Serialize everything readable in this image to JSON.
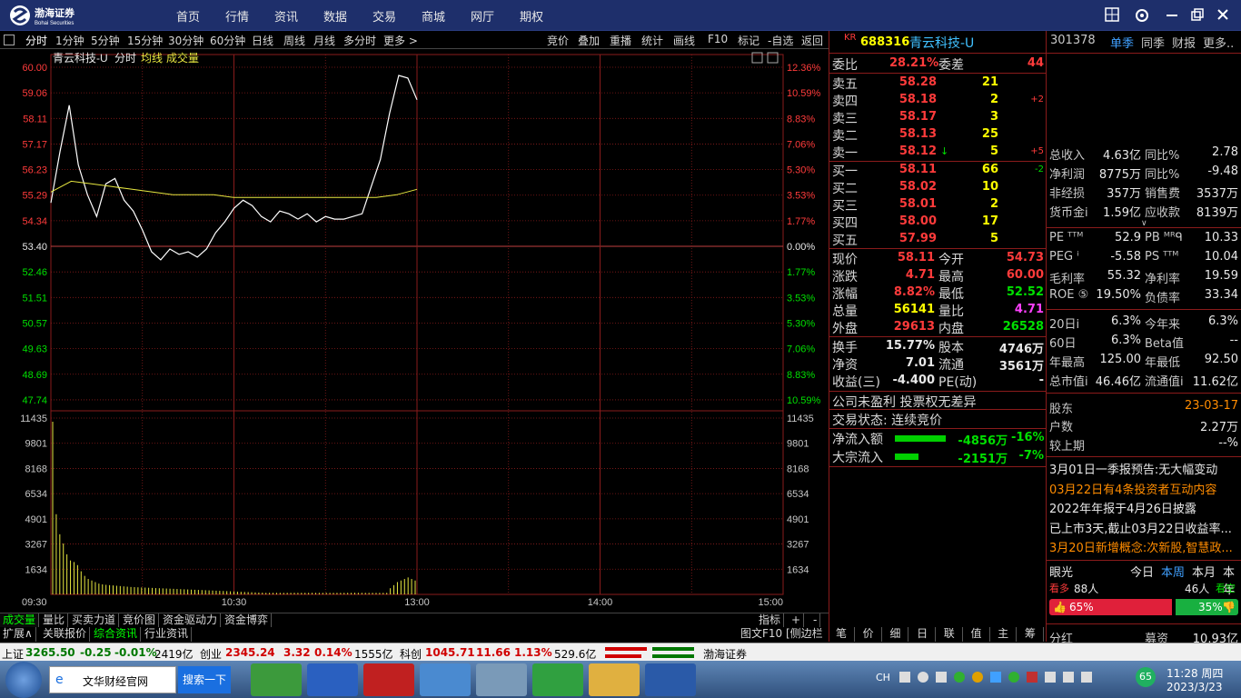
{
  "app": {
    "logo_text": "渤海证券",
    "logo_sub": "Bohai Securities"
  },
  "menu": [
    "首页",
    "行情",
    "资讯",
    "数据",
    "交易",
    "商城",
    "网厅",
    "期权"
  ],
  "periods": [
    "分时",
    "1分钟",
    "5分钟",
    "15分钟",
    "30分钟",
    "60分钟",
    "日线",
    "周线",
    "月线",
    "多分时",
    "更多 >"
  ],
  "tools": [
    "竞价",
    "叠加",
    "重播",
    "统计",
    "画线",
    "F10",
    "标记",
    "-自选",
    "返回"
  ],
  "chart": {
    "name": "青云科技-U",
    "mode": "分时",
    "avg_label": "均线",
    "vol_label": "成交量",
    "price_ticks": [
      "60.00",
      "59.06",
      "58.11",
      "57.17",
      "56.23",
      "55.29",
      "54.34",
      "53.40",
      "52.46",
      "51.51",
      "50.57",
      "49.63",
      "48.69",
      "47.74"
    ],
    "pct_ticks": [
      "12.36%",
      "10.59%",
      "8.83%",
      "7.06%",
      "5.30%",
      "3.53%",
      "1.77%",
      "0.00%",
      "1.77%",
      "3.53%",
      "5.30%",
      "7.06%",
      "8.83%",
      "10.59%"
    ],
    "vol_ticks": [
      "11435",
      "9801",
      "8168",
      "6534",
      "4901",
      "3267",
      "1634"
    ],
    "time_ticks": [
      "09:30",
      "10:30",
      "13:00",
      "14:00",
      "15:00"
    ],
    "colors": {
      "price_line": "#ffffff",
      "avg_line": "#e8e840",
      "grid": "#8a1b1b",
      "up": "#ff3b3b",
      "down": "#00e000",
      "volume": "#e8e840"
    }
  },
  "chart_data": {
    "type": "line",
    "title": "青云科技-U",
    "x_label_times": [
      "09:30",
      "10:30",
      "13:00",
      "14:00",
      "15:00"
    ],
    "ylim": [
      47.74,
      60.0
    ],
    "prev_close": 53.4,
    "series": [
      {
        "name": "分时",
        "values": [
          55.0,
          56.9,
          58.6,
          56.4,
          55.3,
          54.5,
          55.7,
          55.9,
          55.1,
          54.7,
          54.0,
          53.2,
          52.9,
          53.3,
          53.1,
          53.2,
          53.0,
          53.3,
          53.9,
          54.3,
          54.8,
          55.1,
          54.9,
          54.5,
          54.3,
          54.7,
          54.6,
          54.4,
          54.6,
          54.3,
          54.5,
          54.4,
          54.4,
          54.5,
          54.6,
          55.6,
          56.6,
          58.3,
          59.7,
          59.6,
          58.8
        ]
      },
      {
        "name": "均线",
        "values": [
          55.4,
          55.8,
          55.7,
          55.6,
          55.5,
          55.4,
          55.3,
          55.3,
          55.3,
          55.2,
          55.2,
          55.2,
          55.2,
          55.2,
          55.2,
          55.2,
          55.2,
          55.3,
          55.5
        ]
      }
    ],
    "volume": {
      "ylim": [
        0,
        11435
      ],
      "values": [
        11200,
        5200,
        3900,
        3300,
        2600,
        2200,
        2100,
        1900,
        1500,
        1200,
        1000,
        900,
        800,
        700,
        650,
        620,
        600,
        580,
        560,
        540,
        520,
        500,
        480,
        470,
        460,
        450,
        440,
        430,
        420,
        410,
        400,
        390,
        380,
        370,
        360,
        350,
        340,
        330,
        320,
        310,
        300,
        290,
        280,
        270,
        260,
        250,
        240,
        230,
        220,
        210,
        200,
        190,
        180,
        170,
        160,
        150,
        140,
        130,
        120,
        110,
        100,
        100,
        100,
        100,
        100,
        100,
        100,
        100,
        100,
        100,
        100,
        100,
        100,
        100,
        100,
        100,
        100,
        100,
        100,
        100,
        100,
        100,
        100,
        100,
        100,
        100,
        100,
        100,
        100,
        100,
        100,
        100,
        100,
        100,
        100,
        400,
        600,
        800,
        900,
        1000,
        1100,
        1000,
        900
      ]
    }
  },
  "quote": {
    "code_prefix": "KR",
    "code": "688316",
    "name": "青云科技-U",
    "wb_label": "委比",
    "wb_value": "28.21%",
    "wc_label": "委差",
    "wc_value": "44",
    "sells": [
      {
        "label": "卖五",
        "price": "58.28",
        "vol": "21",
        "chg": ""
      },
      {
        "label": "卖四",
        "price": "58.18",
        "vol": "2",
        "chg": "+2"
      },
      {
        "label": "卖三",
        "price": "58.17",
        "vol": "3",
        "chg": ""
      },
      {
        "label": "卖二",
        "price": "58.13",
        "vol": "25",
        "chg": ""
      },
      {
        "label": "卖一",
        "price": "58.12",
        "vol": "5",
        "chg": "+5"
      }
    ],
    "buys": [
      {
        "label": "买一",
        "price": "58.11",
        "vol": "66",
        "chg": "-2"
      },
      {
        "label": "买二",
        "price": "58.02",
        "vol": "10",
        "chg": ""
      },
      {
        "label": "买三",
        "price": "58.01",
        "vol": "2",
        "chg": ""
      },
      {
        "label": "买四",
        "price": "58.00",
        "vol": "17",
        "chg": ""
      },
      {
        "label": "买五",
        "price": "57.99",
        "vol": "5",
        "chg": ""
      }
    ],
    "stats": [
      {
        "l1": "现价",
        "v1": "58.11",
        "c1": "red",
        "l2": "今开",
        "v2": "54.73",
        "c2": "red"
      },
      {
        "l1": "涨跌",
        "v1": "4.71",
        "c1": "red",
        "l2": "最高",
        "v2": "60.00",
        "c2": "red"
      },
      {
        "l1": "涨幅",
        "v1": "8.82%",
        "c1": "red",
        "l2": "最低",
        "v2": "52.52",
        "c2": "green"
      },
      {
        "l1": "总量",
        "v1": "56141",
        "c1": "yellow",
        "l2": "量比",
        "v2": "4.71",
        "c2": "magenta"
      },
      {
        "l1": "外盘",
        "v1": "29613",
        "c1": "red",
        "l2": "内盘",
        "v2": "26528",
        "c2": "green"
      }
    ],
    "stats2": [
      {
        "l1": "换手",
        "v1": "15.77%",
        "l2": "股本",
        "v2": "4746万"
      },
      {
        "l1": "净资",
        "v1": "7.01",
        "l2": "流通",
        "v2": "3561万"
      },
      {
        "l1": "收益(三)",
        "v1": "-4.400",
        "l2": "PE(动)",
        "v2": "-"
      }
    ],
    "notice1": "公司未盈利 投票权无差异",
    "notice2": "交易状态: 连续竞价",
    "flow": [
      {
        "label": "净流入额",
        "value": "-4856万",
        "pct": "-16%"
      },
      {
        "label": "大宗流入",
        "value": "-2151万",
        "pct": "-7%"
      }
    ]
  },
  "f10": {
    "code": "301378",
    "tabs": [
      "单季",
      "同季",
      "财报",
      "更多.."
    ],
    "rows": [
      {
        "l1": "总收入",
        "v1": "4.63亿",
        "l2": "同比%",
        "v2": "2.78"
      },
      {
        "l1": "净利润",
        "v1": "8775万",
        "l2": "同比%",
        "v2": "-9.48"
      },
      {
        "l1": "非经损",
        "v1": "357万",
        "l2": "销售费",
        "v2": "3537万"
      },
      {
        "l1": "货币金i",
        "v1": "1.59亿",
        "l2": "应收款",
        "v2": "8139万"
      }
    ],
    "rows2": [
      {
        "l1": "PE ᵀᵀᴹ",
        "v1": "52.9",
        "l2": "PB ᴹᴿᑫ",
        "v2": "10.33"
      },
      {
        "l1": "PEG ⁱ",
        "v1": "-5.58",
        "l2": "PS ᵀᵀᴹ",
        "v2": "10.04"
      },
      {
        "l1": "毛利率",
        "v1": "55.32",
        "l2": "净利率",
        "v2": "19.59"
      },
      {
        "l1": "ROE ⑤",
        "v1": "19.50%",
        "l2": "负债率",
        "v2": "33.34"
      }
    ],
    "rows3": [
      {
        "l1": "20日i",
        "v1": "6.3%",
        "l2": "今年来",
        "v2": "6.3%"
      },
      {
        "l1": "60日",
        "v1": "6.3%",
        "l2": "Beta值",
        "v2": "--"
      },
      {
        "l1": "年最高",
        "v1": "125.00",
        "l2": "年最低",
        "v2": "92.50"
      },
      {
        "l1": "总市值i",
        "v1": "46.46亿",
        "l2": "流通值i",
        "v2": "11.62亿"
      }
    ],
    "holder_label": "股东",
    "holder_date": "23-03-17",
    "hushu_label": "户数",
    "hushu_value": "2.27万",
    "jsq_label": "较上期",
    "jsq_value": "--%",
    "news": [
      "3月01日一季报预告:无大幅变动",
      "03月22日有4条投资者互动内容",
      "2022年年报于4月26日披露",
      "已上市3天,截止03月22日收益率...",
      "3月20日新增概念:次新股,智慧政..."
    ],
    "news_colors": [
      "#e8e8e8",
      "#ff8c00",
      "#e8e8e8",
      "#e8e8e8",
      "#ff8c00"
    ],
    "yanguang": "眼光",
    "vtabs": [
      "今日",
      "本周",
      "本月",
      "本年"
    ],
    "bull_label": "看多",
    "bull_count": "88人",
    "bear_count": "46人",
    "bear_label": "看空",
    "bull_pct": "65%",
    "bear_pct": "35%",
    "bottom_l": "分红",
    "bottom_m": "募资",
    "bottom_v": "10.93亿"
  },
  "bottom_tabs": [
    "成交量",
    "量比",
    "买卖力道",
    "竞价图",
    "资金驱动力",
    "资金博弈"
  ],
  "bottom_right": [
    "指标",
    "+",
    "-"
  ],
  "bottom_tabs2": [
    "扩展∧",
    "关联报价",
    "综合资讯",
    "行业资讯"
  ],
  "bottom_right2": "图文F10  [侧边栏 »",
  "qtabs": [
    "笔",
    "价",
    "细",
    "日",
    "联",
    "值",
    "主",
    "筹"
  ],
  "ticker": {
    "sh_label": "上证",
    "sh_val": "3265.50",
    "sh_chg": "-0.25",
    "sh_pct": "-0.01%",
    "sh_amt": "2419亿",
    "cy_label": "创业",
    "cy_val": "2345.24",
    "cy_chg": "3.32",
    "cy_pct": "0.14%",
    "cy_amt": "1555亿",
    "kc_label": "科创",
    "kc_val": "1045.71",
    "kc_chg": "11.66",
    "kc_pct": "1.13%",
    "kc_amt": "529.6亿",
    "broker": "渤海证券"
  },
  "taskbar": {
    "search_text": "文华财经官网",
    "search_btn": "搜索一下",
    "time": "11:28 周四",
    "date": "2023/3/23",
    "lang": "CH",
    "badge": "65"
  }
}
